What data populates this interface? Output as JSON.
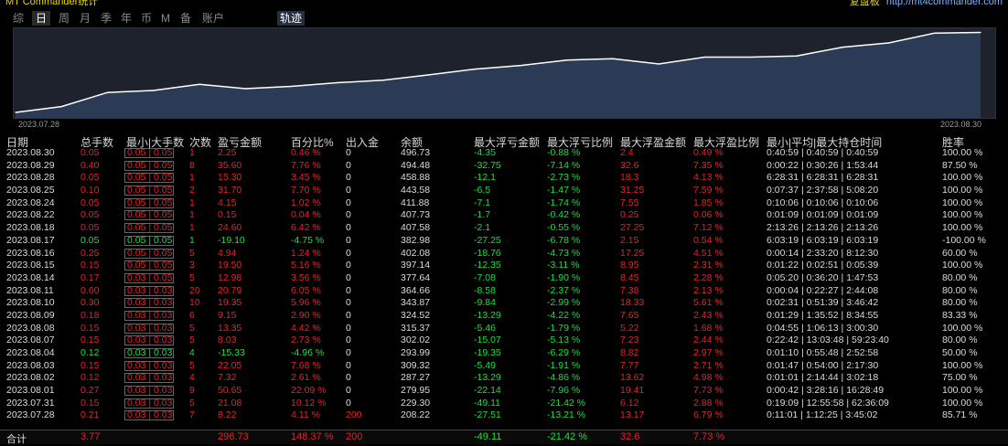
{
  "header": {
    "title_left": "MT Commander统计",
    "link_label": "复盘板",
    "link_url": "http://mt4commander.com"
  },
  "tabs": [
    "综",
    "日",
    "周",
    "月",
    "季",
    "年",
    "币",
    "M",
    "备",
    "账户"
  ],
  "active_tab": "日",
  "track_tab": "轨迹",
  "chart_data": {
    "type": "line",
    "x_start_label": "2023.07.28",
    "x_end_label": "2023.08.30",
    "x": [
      "2023.07.28",
      "2023.07.31",
      "2023.08.01",
      "2023.08.02",
      "2023.08.03",
      "2023.08.04",
      "2023.08.07",
      "2023.08.08",
      "2023.08.09",
      "2023.08.10",
      "2023.08.11",
      "2023.08.14",
      "2023.08.15",
      "2023.08.16",
      "2023.08.17",
      "2023.08.18",
      "2023.08.22",
      "2023.08.24",
      "2023.08.25",
      "2023.08.28",
      "2023.08.29",
      "2023.08.30"
    ],
    "y": [
      208.22,
      229.3,
      279.95,
      287.27,
      309.32,
      293.99,
      302.02,
      315.37,
      324.52,
      343.87,
      364.66,
      377.64,
      397.14,
      402.08,
      382.98,
      407.58,
      407.73,
      411.88,
      443.58,
      458.88,
      494.48,
      496.73
    ],
    "ylim": [
      195,
      505
    ],
    "line_color": "#ffffff",
    "fill_color": "#2b3a55",
    "background": "#1d222c"
  },
  "table": {
    "columns": [
      "日期",
      "总手数",
      "最小|大手数",
      "次数",
      "盈亏金额",
      "百分比%",
      "出入金",
      "余额",
      "最大浮亏金额",
      "最大浮亏比例",
      "最大浮盈金额",
      "最大浮盈比例",
      "最小|平均|最大持仓时间",
      "胜率"
    ],
    "rows": [
      {
        "date": "2023.08.30",
        "lots": "0.05",
        "minmax": "0.05 | 0.05",
        "count": "1",
        "pnl": "2.25",
        "pct": "0.46 %",
        "flow": "0",
        "bal": "496.73",
        "mfl": "-4.35",
        "mflp": "-0.88 %",
        "mfp": "2.4",
        "mfpp": "0.49 %",
        "hold": "0:40:59 | 0:40:59 | 0:40:59",
        "win": "100.00 %",
        "color": "red"
      },
      {
        "date": "2023.08.29",
        "lots": "0.40",
        "minmax": "0.05 | 0.05",
        "count": "8",
        "pnl": "35.60",
        "pct": "7.76 %",
        "flow": "0",
        "bal": "494.48",
        "mfl": "-32.75",
        "mflp": "-7.14 %",
        "mfp": "32.6",
        "mfpp": "7.35 %",
        "hold": "0:00:22 | 0:30:26 | 1:53:44",
        "win": "87.50 %",
        "color": "red"
      },
      {
        "date": "2023.08.28",
        "lots": "0.05",
        "minmax": "0.05 | 0.05",
        "count": "1",
        "pnl": "15.30",
        "pct": "3.45 %",
        "flow": "0",
        "bal": "458.88",
        "mfl": "-12.1",
        "mflp": "-2.73 %",
        "mfp": "18.3",
        "mfpp": "4.13 %",
        "hold": "6:28:31 | 6:28:31 | 6:28:31",
        "win": "100.00 %",
        "color": "red"
      },
      {
        "date": "2023.08.25",
        "lots": "0.10",
        "minmax": "0.05 | 0.05",
        "count": "2",
        "pnl": "31.70",
        "pct": "7.70 %",
        "flow": "0",
        "bal": "443.58",
        "mfl": "-6.5",
        "mflp": "-1.47 %",
        "mfp": "31.25",
        "mfpp": "7.59 %",
        "hold": "0:07:37 | 2:37:58 | 5:08:20",
        "win": "100.00 %",
        "color": "red"
      },
      {
        "date": "2023.08.24",
        "lots": "0.05",
        "minmax": "0.05 | 0.05",
        "count": "1",
        "pnl": "4.15",
        "pct": "1.02 %",
        "flow": "0",
        "bal": "411.88",
        "mfl": "-7.1",
        "mflp": "-1.74 %",
        "mfp": "7.55",
        "mfpp": "1.85 %",
        "hold": "0:10:06 | 0:10:06 | 0:10:06",
        "win": "100.00 %",
        "color": "red"
      },
      {
        "date": "2023.08.22",
        "lots": "0.05",
        "minmax": "0.05 | 0.05",
        "count": "1",
        "pnl": "0.15",
        "pct": "0.04 %",
        "flow": "0",
        "bal": "407.73",
        "mfl": "-1.7",
        "mflp": "-0.42 %",
        "mfp": "0.25",
        "mfpp": "0.06 %",
        "hold": "0:01:09 | 0:01:09 | 0:01:09",
        "win": "100.00 %",
        "color": "red"
      },
      {
        "date": "2023.08.18",
        "lots": "0.05",
        "minmax": "0.05 | 0.05",
        "count": "1",
        "pnl": "24.60",
        "pct": "6.42 %",
        "flow": "0",
        "bal": "407.58",
        "mfl": "-2.1",
        "mflp": "-0.55 %",
        "mfp": "27.25",
        "mfpp": "7.12 %",
        "hold": "2:13:26 | 2:13:26 | 2:13:26",
        "win": "100.00 %",
        "color": "red"
      },
      {
        "date": "2023.08.17",
        "lots": "0.05",
        "minmax": "0.05 | 0.05",
        "count": "1",
        "pnl": "-19.10",
        "pct": "-4.75 %",
        "flow": "0",
        "bal": "382.98",
        "mfl": "-27.25",
        "mflp": "-6.78 %",
        "mfp": "2.15",
        "mfpp": "0.54 %",
        "hold": "6:03:19 | 6:03:19 | 6:03:19",
        "win": "-100.00 %",
        "color": "grn"
      },
      {
        "date": "2023.08.16",
        "lots": "0.25",
        "minmax": "0.05 | 0.05",
        "count": "5",
        "pnl": "4.94",
        "pct": "1.24 %",
        "flow": "0",
        "bal": "402.08",
        "mfl": "-18.76",
        "mflp": "-4.73 %",
        "mfp": "17.25",
        "mfpp": "4.51 %",
        "hold": "0:00:14 | 2:33:20 | 8:12:30",
        "win": "60.00 %",
        "color": "red"
      },
      {
        "date": "2023.08.15",
        "lots": "0.15",
        "minmax": "0.05 | 0.05",
        "count": "3",
        "pnl": "19.50",
        "pct": "5.16 %",
        "flow": "0",
        "bal": "397.14",
        "mfl": "-12.35",
        "mflp": "-3.11 %",
        "mfp": "8.95",
        "mfpp": "2.31 %",
        "hold": "0:01:22 | 0:02:51 | 0:05:39",
        "win": "100.00 %",
        "color": "red"
      },
      {
        "date": "2023.08.14",
        "lots": "0.17",
        "minmax": "0.03 | 0.05",
        "count": "5",
        "pnl": "12.98",
        "pct": "3.56 %",
        "flow": "0",
        "bal": "377.64",
        "mfl": "-7.08",
        "mflp": "-1.90 %",
        "mfp": "8.45",
        "mfpp": "2.28 %",
        "hold": "0:05:20 | 0:36:20 | 1:47:53",
        "win": "80.00 %",
        "color": "red"
      },
      {
        "date": "2023.08.11",
        "lots": "0.60",
        "minmax": "0.03 | 0.03",
        "count": "20",
        "pnl": "20.79",
        "pct": "6.05 %",
        "flow": "0",
        "bal": "364.66",
        "mfl": "-8.58",
        "mflp": "-2.37 %",
        "mfp": "7.38",
        "mfpp": "2.13 %",
        "hold": "0:00:04 | 0:22:27 | 2:44:08",
        "win": "80.00 %",
        "color": "red"
      },
      {
        "date": "2023.08.10",
        "lots": "0.30",
        "minmax": "0.03 | 0.03",
        "count": "10",
        "pnl": "19.35",
        "pct": "5.96 %",
        "flow": "0",
        "bal": "343.87",
        "mfl": "-9.84",
        "mflp": "-2.99 %",
        "mfp": "18.33",
        "mfpp": "5.61 %",
        "hold": "0:02:31 | 0:51:39 | 3:46:42",
        "win": "80.00 %",
        "color": "red"
      },
      {
        "date": "2023.08.09",
        "lots": "0.18",
        "minmax": "0.03 | 0.03",
        "count": "6",
        "pnl": "9.15",
        "pct": "2.90 %",
        "flow": "0",
        "bal": "324.52",
        "mfl": "-13.29",
        "mflp": "-4.22 %",
        "mfp": "7.65",
        "mfpp": "2.43 %",
        "hold": "0:01:29 | 1:35:52 | 8:34:55",
        "win": "83.33 %",
        "color": "red"
      },
      {
        "date": "2023.08.08",
        "lots": "0.15",
        "minmax": "0.03 | 0.03",
        "count": "5",
        "pnl": "13.35",
        "pct": "4.42 %",
        "flow": "0",
        "bal": "315.37",
        "mfl": "-5.46",
        "mflp": "-1.79 %",
        "mfp": "5.22",
        "mfpp": "1.68 %",
        "hold": "0:04:55 | 1:06:13 | 3:00:30",
        "win": "100.00 %",
        "color": "red"
      },
      {
        "date": "2023.08.07",
        "lots": "0.15",
        "minmax": "0.03 | 0.03",
        "count": "5",
        "pnl": "8.03",
        "pct": "2.73 %",
        "flow": "0",
        "bal": "302.02",
        "mfl": "-15.07",
        "mflp": "-5.13 %",
        "mfp": "7.23",
        "mfpp": "2.44 %",
        "hold": "0:22:42 | 13:03:48 | 59:23:40",
        "win": "80.00 %",
        "color": "red"
      },
      {
        "date": "2023.08.04",
        "lots": "0.12",
        "minmax": "0.03 | 0.03",
        "count": "4",
        "pnl": "-15.33",
        "pct": "-4.96 %",
        "flow": "0",
        "bal": "293.99",
        "mfl": "-19.35",
        "mflp": "-6.29 %",
        "mfp": "8.82",
        "mfpp": "2.97 %",
        "hold": "0:01:10 | 0:55:48 | 2:52:58",
        "win": "50.00 %",
        "color": "grn"
      },
      {
        "date": "2023.08.03",
        "lots": "0.15",
        "minmax": "0.03 | 0.03",
        "count": "5",
        "pnl": "22.05",
        "pct": "7.68 %",
        "flow": "0",
        "bal": "309.32",
        "mfl": "-5.49",
        "mflp": "-1.91 %",
        "mfp": "7.77",
        "mfpp": "2.71 %",
        "hold": "0:01:47 | 0:54:00 | 2:17:30",
        "win": "100.00 %",
        "color": "red"
      },
      {
        "date": "2023.08.02",
        "lots": "0.12",
        "minmax": "0.03 | 0.03",
        "count": "4",
        "pnl": "7.32",
        "pct": "2.61 %",
        "flow": "0",
        "bal": "287.27",
        "mfl": "-13.29",
        "mflp": "-4.86 %",
        "mfp": "13.62",
        "mfpp": "4.98 %",
        "hold": "0:01:01 | 2:14:44 | 3:02:18",
        "win": "75.00 %",
        "color": "red"
      },
      {
        "date": "2023.08.01",
        "lots": "0.27",
        "minmax": "0.03 | 0.03",
        "count": "9",
        "pnl": "50.65",
        "pct": "22.09 %",
        "flow": "0",
        "bal": "279.95",
        "mfl": "-22.14",
        "mflp": "-7.96 %",
        "mfp": "19.41",
        "mfpp": "7.73 %",
        "hold": "0:00:42 | 3:28:16 | 16:28:49",
        "win": "100.00 %",
        "color": "red"
      },
      {
        "date": "2023.07.31",
        "lots": "0.15",
        "minmax": "0.03 | 0.03",
        "count": "5",
        "pnl": "21.08",
        "pct": "10.12 %",
        "flow": "0",
        "bal": "229.30",
        "mfl": "-49.11",
        "mflp": "-21.42 %",
        "mfp": "6.12",
        "mfpp": "2.88 %",
        "hold": "0:19:09 | 12:55:58 | 62:36:09",
        "win": "100.00 %",
        "color": "red"
      },
      {
        "date": "2023.07.28",
        "lots": "0.21",
        "minmax": "0.03 | 0.03",
        "count": "7",
        "pnl": "8.22",
        "pct": "4.11 %",
        "flow": "200",
        "bal": "208.22",
        "mfl": "-27.51",
        "mflp": "-13.21 %",
        "mfp": "13.17",
        "mfpp": "6.79 %",
        "hold": "0:11:01 | 1:12:25 | 3:45:02",
        "win": "85.71 %",
        "color": "red"
      }
    ],
    "total": {
      "label": "合计",
      "lots": "3.77",
      "pnl": "296.73",
      "pct": "148.37 %",
      "flow": "200",
      "mfl": "-49.11",
      "mflp": "-21.42 %",
      "mfp": "32.6",
      "mfpp": "7.73 %"
    }
  },
  "colors": {
    "profit": "#e8202a",
    "loss": "#19e040",
    "text": "#dcdcdc",
    "background": "#000000"
  }
}
